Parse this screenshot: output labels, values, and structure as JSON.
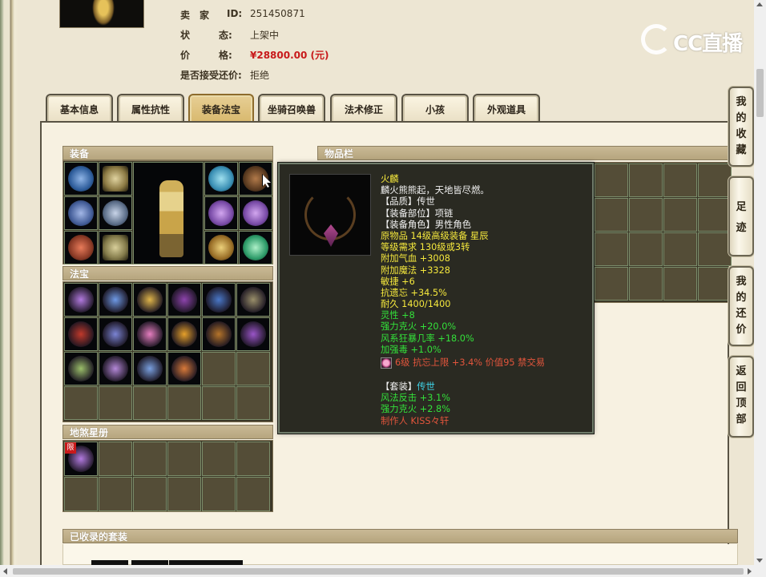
{
  "seller": {
    "id_label": "卖　家",
    "id_key": "ID:",
    "id_value": "251450871",
    "status_label": "状　　　态:",
    "status_value": "上架中",
    "price_label": "价　　　格:",
    "price_value": "¥28800.00 (元)",
    "bargain_label": "是否接受还价:",
    "bargain_value": "拒绝"
  },
  "watermark": {
    "text": "CC直播"
  },
  "tabs": [
    {
      "label": "基本信息"
    },
    {
      "label": "属性抗性"
    },
    {
      "label": "装备法宝",
      "active": true
    },
    {
      "label": "坐骑召唤兽"
    },
    {
      "label": "法术修正"
    },
    {
      "label": "小孩"
    },
    {
      "label": "外观道具"
    }
  ],
  "sections": {
    "equipment": "装备",
    "treasure": "法宝",
    "star_book": "地煞星册",
    "inventory": "物品栏",
    "collected_sets": "已收录的套装"
  },
  "star_book_badge": "限",
  "tooltip": {
    "name": "火麟",
    "desc": "麟火熊熊起，天地皆尽燃。",
    "quality_key": "【品质】",
    "quality_val": "传世",
    "slot_key": "【装备部位】",
    "slot_val": "项链",
    "role_key": "【装备角色】",
    "role_val": "男性角色",
    "origin": "原物品 14级高级装备 星辰",
    "requirement": "等级需求 130级或3转",
    "stats_base": [
      "附加气血 +3008",
      "附加魔法 +3328",
      "敏捷 +6",
      "抗遗忘 +34.5%",
      "耐久 1400/1400"
    ],
    "stats_extra": [
      "灵性 +8",
      "强力克火 +20.0%",
      "风系狂暴几率 +18.0%",
      "加强毒 +1.0%"
    ],
    "gem_line": "6级 抗忘上限 +3.4% 价值95 禁交易",
    "set_key": "【套装】",
    "set_val": "传世",
    "set_stats": [
      "风法反击 +3.1%",
      "强力克火 +2.8%"
    ],
    "maker": "制作人 KISS々轩"
  },
  "sidenav": [
    {
      "label": "我的收藏"
    },
    {
      "label": "足迹"
    },
    {
      "label": "我的还价"
    },
    {
      "label": "返回顶部"
    }
  ]
}
